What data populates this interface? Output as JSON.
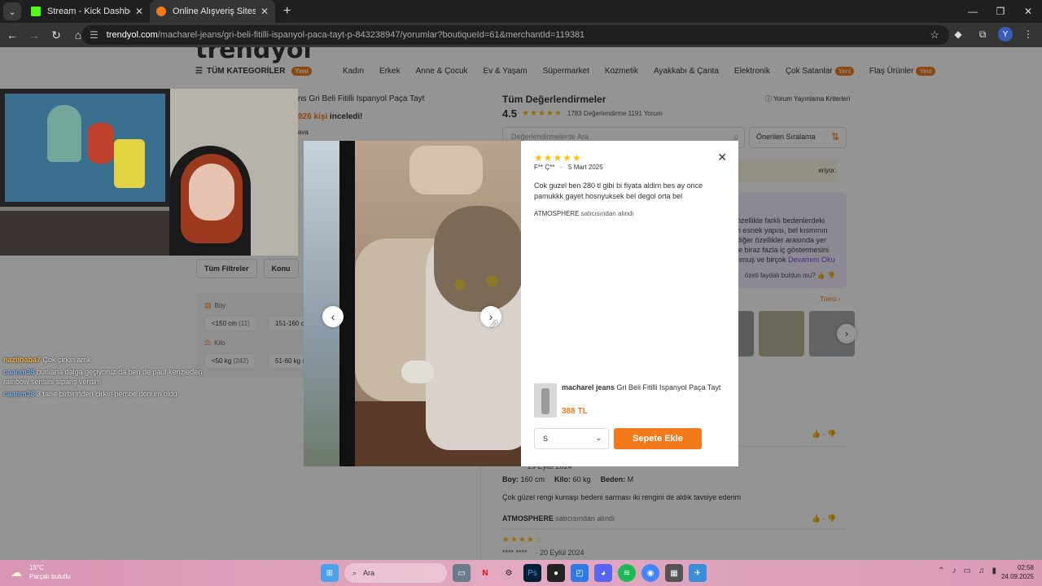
{
  "browser": {
    "tabs": [
      {
        "title": "Stream - Kick Dashboard",
        "favicon_color": "#53fc18",
        "active": false
      },
      {
        "title": "Online Alışveriş Sitesi, Türkiye'nin",
        "favicon_color": "#f27a1a",
        "active": true
      }
    ],
    "url_host": "trendyol.com",
    "url_rest": "/macharel-jeans/gri-beli-fitilli-ispanyol-paca-tayt-p-843238947/yorumlar?boutiqueId=61&merchantId=119381",
    "profile_initial": "Y"
  },
  "nav": {
    "all_categories": "TÜM KATEGORİLER",
    "new_badge": "Yeni",
    "categories": [
      "Kadın",
      "Erkek",
      "Anne & Çocuk",
      "Ev & Yaşam",
      "Süpermarket",
      "Kozmetik",
      "Ayakkabı & Çanta",
      "Elektronik"
    ],
    "best_sellers": "Çok Satanlar",
    "flash": "Flaş Ürünler"
  },
  "product": {
    "title_partial": "ns Gri Beli Fitilli Ispanyol Paça Tayt",
    "viewed_count": "926 kişi",
    "viewed_suffix": " inceledi!",
    "ava": "ava"
  },
  "reviews": {
    "heading": "Tüm Değerlendirmeler",
    "criteria": "Yorum Yayınlama Kriterleri",
    "score": "4.5",
    "counts": "1783 Değerlendirme  1191 Yorum",
    "search_placeholder": "Değerlendirmelerde Ara",
    "sort_label": "Önerilen Sıralama",
    "info_text": "eriyor.",
    "ai_lines": [
      "özellikle farklı bedenlerdeki",
      "n esnek yapısı, bel kısmının",
      "diğer özellikler arasında yer",
      "le biraz fazla iç göstermesini",
      "nmuş ve birçok"
    ],
    "ai_more": "Devamını Oku",
    "ai_feedback": "özeti faydalı buldun mu?",
    "photos_all": "Tümü",
    "review2": {
      "date": "  ** *   · 29 Eylül 2024",
      "boy_label": "Boy:",
      "boy_value": "160 cm",
      "kilo_label": "Kilo:",
      "kilo_value": "60 kg",
      "beden_label": "Beden:",
      "beden_value": "M",
      "text": "Çok güzel rengi kumaşı bedeni sarması iki rengini de aldık tavsiye ederim",
      "seller": "ATMOSPHERE",
      "seller_suffix": " satıcısından alındı"
    },
    "review3": {
      "stars": "★★★★☆",
      "date": "**** ****    · 20 Eylül 2024"
    }
  },
  "filters": {
    "buttons": [
      "Tüm Filtreler",
      "Konu"
    ],
    "boy_label": "Boy",
    "kilo_label": "Kilo",
    "boy_chips": [
      {
        "label": "<150 cm",
        "count": "(11)"
      },
      {
        "label": "151-160 cm",
        "count": ""
      }
    ],
    "kilo_chips": [
      {
        "label": "<50 kg",
        "count": "(242)"
      },
      {
        "label": "51-60 kg",
        "count": "(3"
      }
    ]
  },
  "chat": [
    {
      "user": "nazlibaba7",
      "user_color": "#f0b23e",
      "msg": "Çok çirkin amk"
    },
    {
      "user": "caanm38",
      "user_color": "#7fb4e6",
      "msg": "bunlarla dalga geçiyoruz da ben de paul kenzieden rainbow serisini sipariş verdim"
    },
    {
      "user": "caanm38",
      "user_color": "#7fb4e6",
      "msg": "3 tane birbirinden çirkin pembe donum oldu"
    }
  ],
  "modal": {
    "stars": "★★★★★",
    "author": "F** Ç**",
    "date": "5 Mart 2025",
    "text": "Cok guzel ben 280 tl gibi bi fiyata aldim bes ay once pamukkk gayet hosnyuksek bel degol orta bel",
    "seller": "ATMOSPHERE",
    "seller_suffix": " satıcısından alındı",
    "product_brand": "macharel jeans",
    "product_name": " Gri Beli Fitilli Ispanyol Paça Tayt",
    "price": "388 TL",
    "size": "S",
    "add_to_cart": "Sepete Ekle"
  },
  "taskbar": {
    "temp": "15°C",
    "weather": "Parçalı bulutlu",
    "search": "Ara",
    "time": "02:58",
    "date": "24.09.2025"
  },
  "colors": {
    "accent": "#f27a1a",
    "star": "#ffc000"
  }
}
